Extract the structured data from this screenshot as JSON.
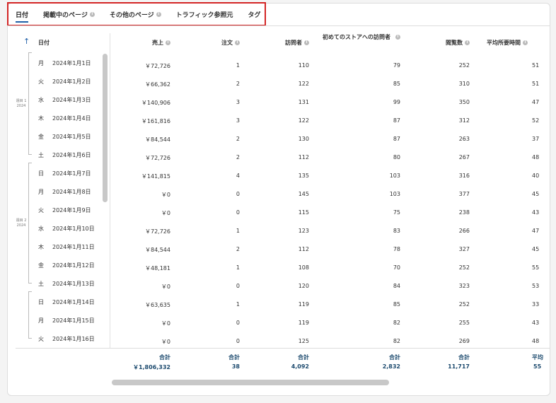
{
  "tabs": [
    {
      "label": "日付",
      "info": false
    },
    {
      "label": "掲載中のページ",
      "info": true
    },
    {
      "label": "その他のページ",
      "info": true
    },
    {
      "label": "トラフィック参照元",
      "info": false
    },
    {
      "label": "タグ",
      "info": false
    }
  ],
  "date_header": "日付",
  "columns": [
    {
      "label": "売上",
      "info": true
    },
    {
      "label": "注文",
      "info": true
    },
    {
      "label": "訪問者",
      "info": true
    },
    {
      "label": "初めてのストアへの訪問者",
      "info": true
    },
    {
      "label": "閲覧数",
      "info": true
    },
    {
      "label": "平均所要時間",
      "info": true
    }
  ],
  "weeks": [
    {
      "label": "週目 1",
      "year": "2024"
    },
    {
      "label": "週目 2",
      "year": "2024"
    }
  ],
  "rows": [
    {
      "day": "月",
      "date": "2024年1月1日",
      "sales": "￥72,726",
      "orders": "1",
      "visitors": "110",
      "first": "79",
      "views": "252",
      "avg": "51"
    },
    {
      "day": "火",
      "date": "2024年1月2日",
      "sales": "￥66,362",
      "orders": "2",
      "visitors": "122",
      "first": "85",
      "views": "310",
      "avg": "51"
    },
    {
      "day": "水",
      "date": "2024年1月3日",
      "sales": "￥140,906",
      "orders": "3",
      "visitors": "131",
      "first": "99",
      "views": "350",
      "avg": "47"
    },
    {
      "day": "木",
      "date": "2024年1月4日",
      "sales": "￥161,816",
      "orders": "3",
      "visitors": "122",
      "first": "87",
      "views": "312",
      "avg": "52"
    },
    {
      "day": "金",
      "date": "2024年1月5日",
      "sales": "￥84,544",
      "orders": "2",
      "visitors": "130",
      "first": "87",
      "views": "263",
      "avg": "37"
    },
    {
      "day": "土",
      "date": "2024年1月6日",
      "sales": "￥72,726",
      "orders": "2",
      "visitors": "112",
      "first": "80",
      "views": "267",
      "avg": "48"
    },
    {
      "day": "日",
      "date": "2024年1月7日",
      "sales": "￥141,815",
      "orders": "4",
      "visitors": "135",
      "first": "103",
      "views": "316",
      "avg": "40"
    },
    {
      "day": "月",
      "date": "2024年1月8日",
      "sales": "￥0",
      "orders": "0",
      "visitors": "145",
      "first": "103",
      "views": "377",
      "avg": "45"
    },
    {
      "day": "火",
      "date": "2024年1月9日",
      "sales": "￥0",
      "orders": "0",
      "visitors": "115",
      "first": "75",
      "views": "238",
      "avg": "43"
    },
    {
      "day": "水",
      "date": "2024年1月10日",
      "sales": "￥72,726",
      "orders": "1",
      "visitors": "123",
      "first": "83",
      "views": "266",
      "avg": "47"
    },
    {
      "day": "木",
      "date": "2024年1月11日",
      "sales": "￥84,544",
      "orders": "2",
      "visitors": "112",
      "first": "78",
      "views": "327",
      "avg": "45"
    },
    {
      "day": "金",
      "date": "2024年1月12日",
      "sales": "￥48,181",
      "orders": "1",
      "visitors": "108",
      "first": "70",
      "views": "252",
      "avg": "55"
    },
    {
      "day": "土",
      "date": "2024年1月13日",
      "sales": "￥0",
      "orders": "0",
      "visitors": "120",
      "first": "84",
      "views": "323",
      "avg": "53"
    },
    {
      "day": "日",
      "date": "2024年1月14日",
      "sales": "￥63,635",
      "orders": "1",
      "visitors": "119",
      "first": "85",
      "views": "252",
      "avg": "33"
    },
    {
      "day": "月",
      "date": "2024年1月15日",
      "sales": "￥0",
      "orders": "0",
      "visitors": "119",
      "first": "82",
      "views": "255",
      "avg": "43"
    },
    {
      "day": "火",
      "date": "2024年1月16日",
      "sales": "￥0",
      "orders": "0",
      "visitors": "125",
      "first": "82",
      "views": "269",
      "avg": "48"
    }
  ],
  "totals": [
    {
      "label": "合計",
      "value": "￥1,806,332"
    },
    {
      "label": "合計",
      "value": "38"
    },
    {
      "label": "合計",
      "value": "4,092"
    },
    {
      "label": "合計",
      "value": "2,832"
    },
    {
      "label": "合計",
      "value": "11,717"
    },
    {
      "label": "平均",
      "value": "55"
    }
  ],
  "colors": {
    "accent": "#1f5fa8",
    "highlight": "#d32525",
    "totals": "#1c4a6e"
  }
}
